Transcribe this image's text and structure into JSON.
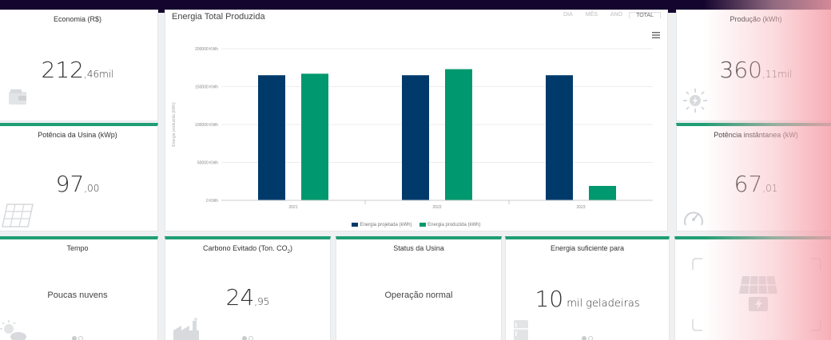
{
  "cards": {
    "economia": {
      "title": "Economia (R$)",
      "value": "212",
      "unit": ",46mil"
    },
    "producao": {
      "title": "Produção (kWh)",
      "value": "360",
      "unit": ",11mil"
    },
    "potencia_usina": {
      "title": "Potência da Usina (kWp)",
      "value": "97",
      "unit": ",00"
    },
    "potencia_inst": {
      "title": "Potência instântanea (kW)",
      "value": "67",
      "unit": ",01"
    },
    "tempo": {
      "title": "Tempo",
      "text": "Poucas nuvens"
    },
    "carbono": {
      "title_prefix": "Carbono Evitado (Ton. CO",
      "title_sub": "2",
      "title_suffix": ")",
      "value": "24",
      "unit": ",95"
    },
    "status": {
      "title": "Status da Usina",
      "text": "Operação normal"
    },
    "energia": {
      "title": "Energia suficiente para",
      "value": "10",
      "unit": " mil geladeiras"
    }
  },
  "chart_panel": {
    "title": "Energia Total Produzida",
    "tabs": [
      "DIA",
      "MÊS",
      "ANO",
      "TOTAL"
    ],
    "active_tab": "TOTAL",
    "menu_icon": "hamburger-icon"
  },
  "colors": {
    "accent": "#1f9e73",
    "projected": "#003a6b",
    "produced": "#00986e"
  },
  "chart_data": {
    "type": "bar",
    "categories": [
      "2021",
      "2022",
      "2023"
    ],
    "series": [
      {
        "name": "Energia projetada (kWh)",
        "values": [
          165000,
          165000,
          165000
        ]
      },
      {
        "name": "Energia produzida (kWh)",
        "values": [
          167000,
          173000,
          19000
        ]
      }
    ],
    "ylabel": "Energia produzida (kWh)",
    "yticks": [
      "0 KWh",
      "50000 KWh",
      "100000 KWh",
      "150000 KWh",
      "200000 KWh"
    ],
    "ylim": [
      0,
      200000
    ],
    "grid": true,
    "legend": "bottom"
  }
}
